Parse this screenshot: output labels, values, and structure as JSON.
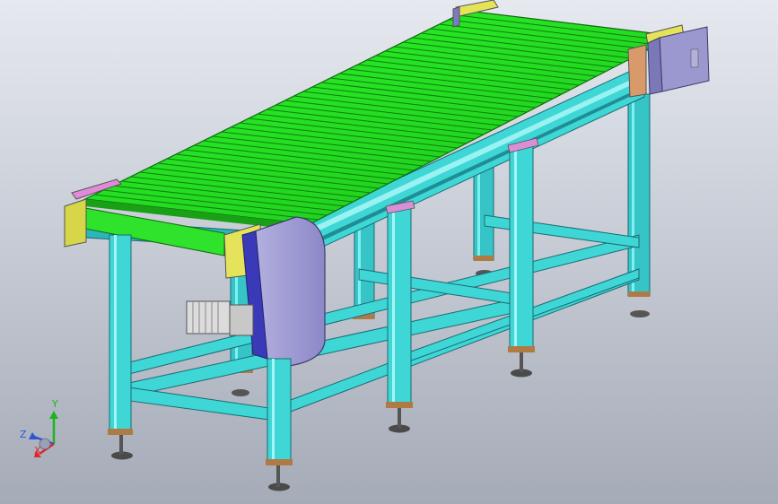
{
  "view": {
    "background_top": "#e6e9ef",
    "background_bottom": "#a5abb7"
  },
  "model": {
    "belt_color": "#25e61f",
    "frame_color": "#3fd6d6",
    "end_cap_color": "#e5e35a",
    "guard_color": "#9a98cf",
    "motor_color": "#dcdcdc",
    "foot_color": "#6b6b6b"
  },
  "triad": {
    "x_label": "X",
    "y_label": "Y",
    "z_label": "Z",
    "x_color": "#e0262c",
    "y_color": "#1fb31f",
    "z_color": "#2e55d6"
  }
}
